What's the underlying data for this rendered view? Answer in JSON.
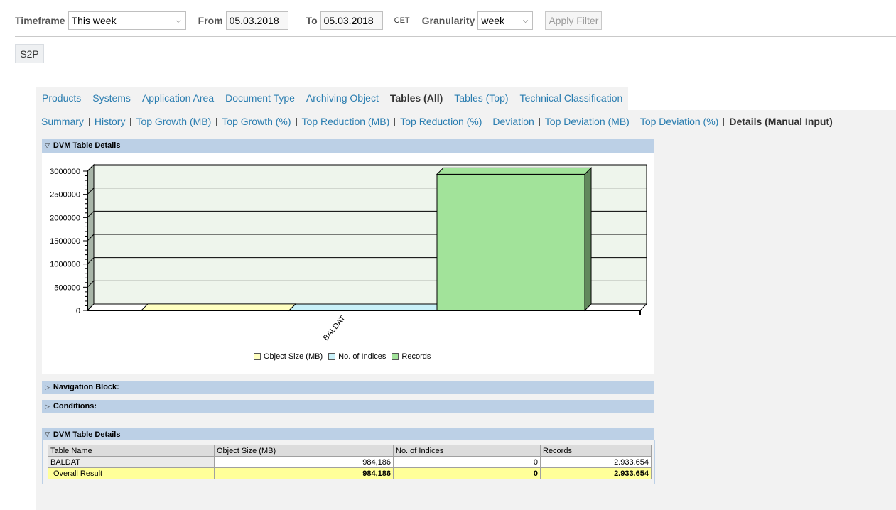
{
  "filter": {
    "timeframe_label": "Timeframe",
    "timeframe_value": "This week",
    "from_label": "From",
    "from_value": "05.03.2018",
    "to_label": "To",
    "to_value": "05.03.2018",
    "timezone": "CET",
    "granularity_label": "Granularity",
    "granularity_value": "week",
    "apply_label": "Apply Filter"
  },
  "top_tab": "S2P",
  "main_tabs": [
    {
      "label": "Products"
    },
    {
      "label": "Systems"
    },
    {
      "label": "Application Area"
    },
    {
      "label": "Document Type"
    },
    {
      "label": "Archiving Object"
    },
    {
      "label": "Tables (All)",
      "active": true
    },
    {
      "label": "Tables (Top)"
    },
    {
      "label": "Technical Classification"
    }
  ],
  "sub_tabs": [
    {
      "label": "Summary"
    },
    {
      "label": "History"
    },
    {
      "label": "Top Growth (MB)"
    },
    {
      "label": "Top Growth (%)"
    },
    {
      "label": "Top Reduction (MB)"
    },
    {
      "label": "Top Reduction (%)"
    },
    {
      "label": "Deviation"
    },
    {
      "label": "Top Deviation (MB)"
    },
    {
      "label": "Top Deviation (%)"
    },
    {
      "label": "Details (Manual Input)",
      "active": true
    }
  ],
  "panels": {
    "chart_panel_title": "DVM Table Details",
    "navigation_title": "Navigation Block:",
    "conditions_title": "Conditions:",
    "table_panel_title": "DVM Table Details"
  },
  "chart_data": {
    "type": "bar",
    "categories": [
      "BALDAT"
    ],
    "series": [
      {
        "name": "Object Size (MB)",
        "values": [
          984.186
        ],
        "color": "#ffffc0"
      },
      {
        "name": "No. of Indices",
        "values": [
          0
        ],
        "color": "#c8f0f8"
      },
      {
        "name": "Records",
        "values": [
          2933654
        ],
        "color": "#a2e39a"
      }
    ],
    "ylim": [
      0,
      3000000
    ],
    "yticks": [
      0,
      500000,
      1000000,
      1500000,
      2000000,
      2500000,
      3000000
    ],
    "legend_position": "bottom",
    "grid": true
  },
  "table": {
    "headers": [
      "Table Name",
      "Object Size (MB)",
      "No. of Indices",
      "Records"
    ],
    "rows": [
      [
        "BALDAT",
        "984,186",
        "0",
        "2.933.654"
      ]
    ],
    "total": [
      "Overall Result",
      "984,186",
      "0",
      "2.933.654"
    ]
  },
  "colors": {
    "link": "#2a7db0",
    "panel_header": "#bcd0e6",
    "total_row": "#ffff99",
    "plot_bg": "#eef5ec"
  }
}
